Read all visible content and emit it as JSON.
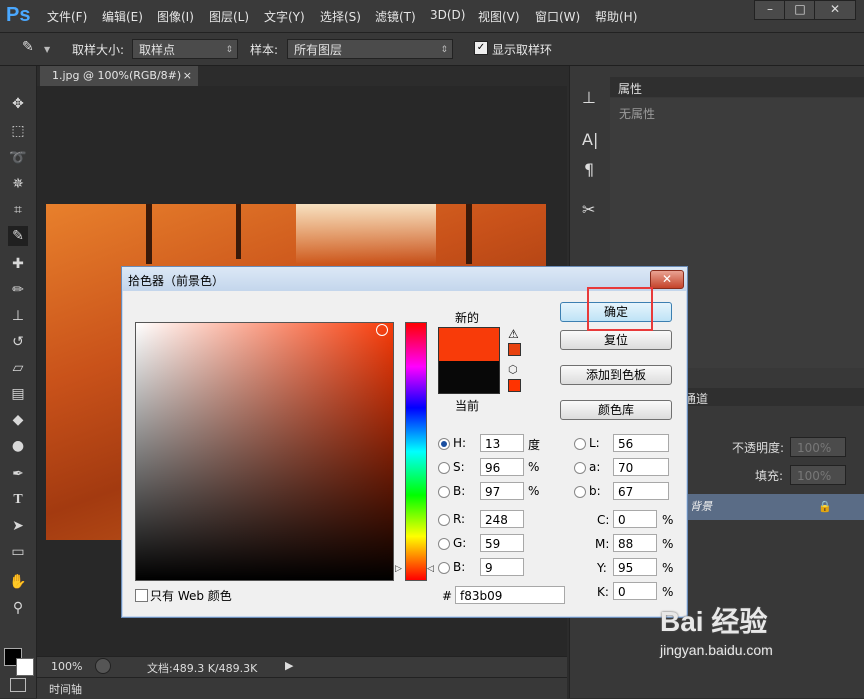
{
  "app": {
    "logo": "Ps"
  },
  "menu": [
    "文件(F)",
    "编辑(E)",
    "图像(I)",
    "图层(L)",
    "文字(Y)",
    "选择(S)",
    "滤镜(T)",
    "3D(D)",
    "视图(V)",
    "窗口(W)",
    "帮助(H)"
  ],
  "window_buttons": {
    "minimize": "–",
    "maximize": "□",
    "close": "✕"
  },
  "options_bar": {
    "sample_size_label": "取样大小:",
    "sample_size_value": "取样点",
    "sample_label": "样本:",
    "sample_value": "所有图层",
    "show_ring_label": "显示取样环",
    "show_ring_checked": true
  },
  "document": {
    "tab_title": "1.jpg @ 100%(RGB/8#)",
    "tab_close": "×"
  },
  "status": {
    "zoom": "100%",
    "doc_info": "文档:489.3 K/489.3K",
    "timeline": "时间轴"
  },
  "properties": {
    "tab": "属性",
    "empty_text": "无属性"
  },
  "layers": {
    "tab_partial": "通道",
    "opacity_label": "不透明度:",
    "opacity_value": "100%",
    "fill_label": "填充:",
    "fill_value": "100%",
    "layer_name": "背景"
  },
  "dialog": {
    "title": "拾色器（前景色）",
    "close": "✕",
    "new_label": "新的",
    "current_label": "当前",
    "new_color": "#f83b09",
    "current_color": "#080808",
    "buttons": {
      "ok": "确定",
      "reset": "复位",
      "add_swatch": "添加到色板",
      "color_library": "颜色库"
    },
    "hsb": {
      "h_label": "H:",
      "h_value": "13",
      "h_unit": "度",
      "s_label": "S:",
      "s_value": "96",
      "s_unit": "%",
      "b_label": "B:",
      "b_value": "97",
      "b_unit": "%"
    },
    "lab": {
      "l_label": "L:",
      "l_value": "56",
      "a_label": "a:",
      "a_value": "70",
      "b_label": "b:",
      "b_value": "67"
    },
    "rgb": {
      "r_label": "R:",
      "r_value": "248",
      "g_label": "G:",
      "g_value": "59",
      "b_label": "B:",
      "b_value": "9"
    },
    "cmyk": {
      "c_label": "C:",
      "c_value": "0",
      "m_label": "M:",
      "m_value": "88",
      "y_label": "Y:",
      "y_value": "95",
      "k_label": "K:",
      "k_value": "0",
      "unit": "%"
    },
    "hex_label": "#",
    "hex_value": "f83b09",
    "web_only_label": "只有 Web 颜色",
    "selected_mode": "H"
  },
  "watermark": {
    "brand": "Bai 经验",
    "url": "jingyan.baidu.com"
  },
  "colors": {
    "accent_red": "#e83a3a",
    "layer_selected": "#5a6c86"
  }
}
